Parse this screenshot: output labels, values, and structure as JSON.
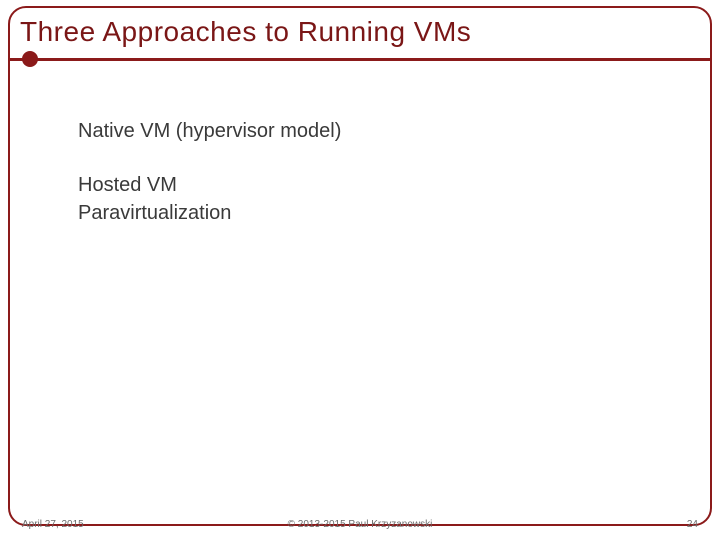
{
  "title": "Three  Approaches to Running VMs",
  "bullets": {
    "item1": "Native VM (hypervisor model)",
    "item2": "Hosted VM",
    "item3": "Paravirtualization"
  },
  "footer": {
    "date": "April 27, 2015",
    "copyright": "© 2013-2015 Paul Krzyzanowski",
    "page": "24"
  }
}
